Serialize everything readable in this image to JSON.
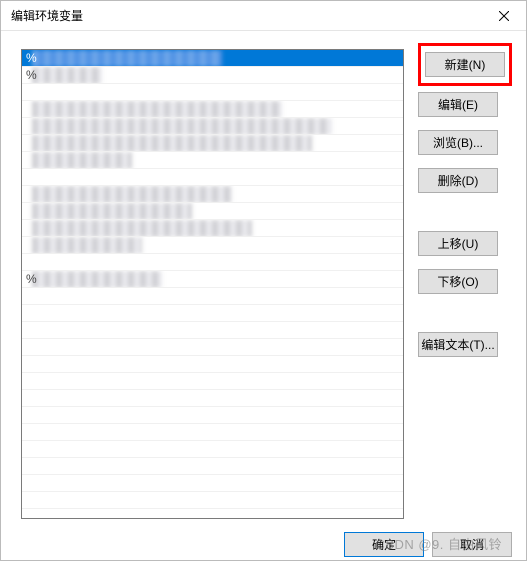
{
  "dialog": {
    "title": "编辑环境变量",
    "close_icon": "close-icon"
  },
  "list": {
    "selected_index": 0,
    "rows": [
      {
        "prefix": "%",
        "blur_width": 190,
        "selected": true
      },
      {
        "prefix": "%",
        "blur_width": 70,
        "selected": false
      },
      {
        "prefix": "",
        "blur_width": 0,
        "selected": false
      },
      {
        "prefix": "",
        "blur_width": 250,
        "selected": false
      },
      {
        "prefix": "",
        "blur_width": 300,
        "selected": false
      },
      {
        "prefix": "",
        "blur_width": 280,
        "selected": false
      },
      {
        "prefix": "",
        "blur_width": 100,
        "selected": false
      },
      {
        "prefix": "",
        "blur_width": 0,
        "selected": false
      },
      {
        "prefix": "",
        "blur_width": 200,
        "selected": false
      },
      {
        "prefix": "",
        "blur_width": 160,
        "selected": false
      },
      {
        "prefix": "",
        "blur_width": 220,
        "selected": false
      },
      {
        "prefix": "",
        "blur_width": 110,
        "selected": false
      },
      {
        "prefix": "",
        "blur_width": 0,
        "selected": false
      },
      {
        "prefix": "%",
        "blur_width": 130,
        "selected": false
      }
    ]
  },
  "buttons": {
    "new": "新建(N)",
    "edit": "编辑(E)",
    "browse": "浏览(B)...",
    "delete": "删除(D)",
    "move_up": "上移(U)",
    "move_down": "下移(O)",
    "edit_text": "编辑文本(T)...",
    "ok": "确定",
    "cancel": "取消"
  },
  "watermark": "CSDN @9. 自由风铃"
}
